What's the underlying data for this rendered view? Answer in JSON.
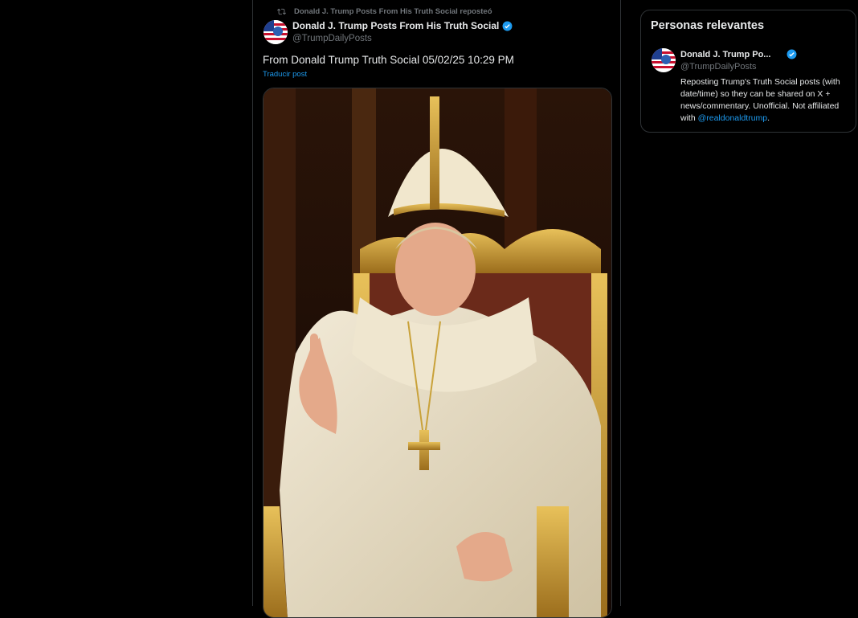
{
  "post": {
    "repost_text": "Donald J. Trump Posts From His Truth Social reposteó",
    "author_name": "Donald J. Trump Posts From His Truth Social",
    "author_handle": "@TrumpDailyPosts",
    "text": "From Donald Trump Truth Social 05/02/25 10:29 PM",
    "translate_label": "Traducir post",
    "media_description": "image"
  },
  "sidebar": {
    "title": "Personas relevantes",
    "person": {
      "name": "Donald J. Trump Po...",
      "handle": "@TrumpDailyPosts",
      "bio_text": "Reposting Trump's Truth Social posts (with date/time) so they can be shared on X + news/commentary. Unofficial. Not affiliated with ",
      "bio_mention": "@realdonaldtrump",
      "bio_end": "."
    }
  },
  "colors": {
    "background": "#000000",
    "border": "#2f3336",
    "text_primary": "#e7e9ea",
    "text_secondary": "#71767b",
    "accent": "#1d9bf0"
  },
  "icons": [
    "repost-icon",
    "verified-badge-icon",
    "avatar-flag-icon"
  ]
}
